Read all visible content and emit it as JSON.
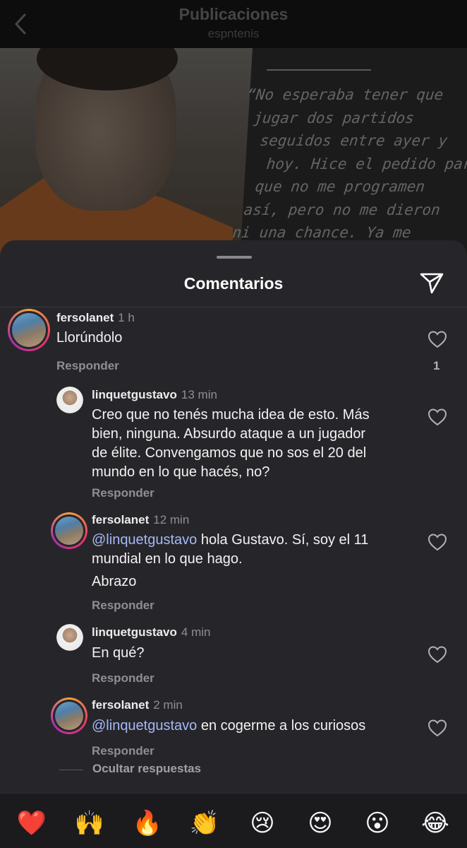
{
  "header": {
    "title": "Publicaciones",
    "subtitle": "espntenis"
  },
  "post": {
    "quote_lines": [
      "“No esperaba tener que",
      " jugar dos partidos",
      "  seguidos entre ayer y",
      "   hoy. Hice el pedido para",
      "  que no me programen",
      " así, pero no me dieron",
      "ni una chance. Ya me"
    ]
  },
  "sheet": {
    "title": "Comentarios"
  },
  "comments": [
    {
      "username": "fersolanet",
      "time": "1 h",
      "text": "Llorúndolo",
      "reply_label": "Responder",
      "likes": "1"
    },
    {
      "username": "linquetgustavo",
      "time": "13 min",
      "text_lines": [
        "Creo que no tenés mucha idea de esto. Más",
        "bien, ninguna.  Absurdo ataque a un jugador",
        "de élite.  Convengamos que no sos el 20 del",
        "mundo en lo que hacés, no?"
      ],
      "reply_label": "Responder"
    },
    {
      "username": "fersolanet",
      "time": "12 min",
      "mention": "@linquetgustavo",
      "text_after_mention": " hola Gustavo. Sí, soy el 11",
      "text_line2": "mundial en lo que hago.",
      "text_line3": "Abrazo",
      "reply_label": "Responder"
    },
    {
      "username": "linquetgustavo",
      "time": "4 min",
      "text": "En qué?",
      "reply_label": "Responder"
    },
    {
      "username": "fersolanet",
      "time": "2 min",
      "mention": "@linquetgustavo",
      "text_after_mention": " en cogerme a los curiosos",
      "reply_label": "Responder"
    }
  ],
  "hide_replies_label": "Ocultar respuestas",
  "emojis": [
    "❤️",
    "🙌",
    "🔥",
    "👏",
    "😢",
    "😍",
    "😮",
    "😂"
  ],
  "icons": {
    "back": "chevron-left-icon",
    "send": "paper-plane-icon",
    "like": "heart-outline-icon"
  },
  "colors": {
    "background": "#26262a",
    "mention": "#a6b8f5",
    "secondary_text": "#8e8e93"
  }
}
